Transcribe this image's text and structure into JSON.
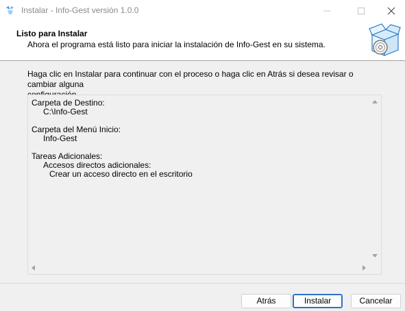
{
  "window": {
    "title": "Instalar - Info-Gest versión 1.0.0"
  },
  "header": {
    "title": "Listo para Instalar",
    "subtitle": "Ahora el programa está listo para iniciar la instalación de Info-Gest en su sistema."
  },
  "body": {
    "instructions_line1": "Haga clic en Instalar para continuar con el proceso o haga clic en Atrás si desea revisar o cambiar alguna",
    "instructions_line2": "configuración."
  },
  "memo": {
    "dest_label": "Carpeta de Destino:",
    "dest_value": "C:\\Info-Gest",
    "menu_label": "Carpeta del Menú Inicio:",
    "menu_value": "Info-Gest",
    "tasks_label": "Tareas Adicionales:",
    "tasks_group": "Accesos directos adicionales:",
    "tasks_item": "Crear un acceso directo en el escritorio"
  },
  "buttons": {
    "back": "Atrás",
    "install": "Instalar",
    "cancel": "Cancelar"
  },
  "colors": {
    "accent": "#2e6fc9",
    "background": "#f0f0f0",
    "title_text": "#8a8a8a"
  },
  "icons": {
    "app": "setup-app-icon",
    "installer": "box-disc-icon"
  }
}
